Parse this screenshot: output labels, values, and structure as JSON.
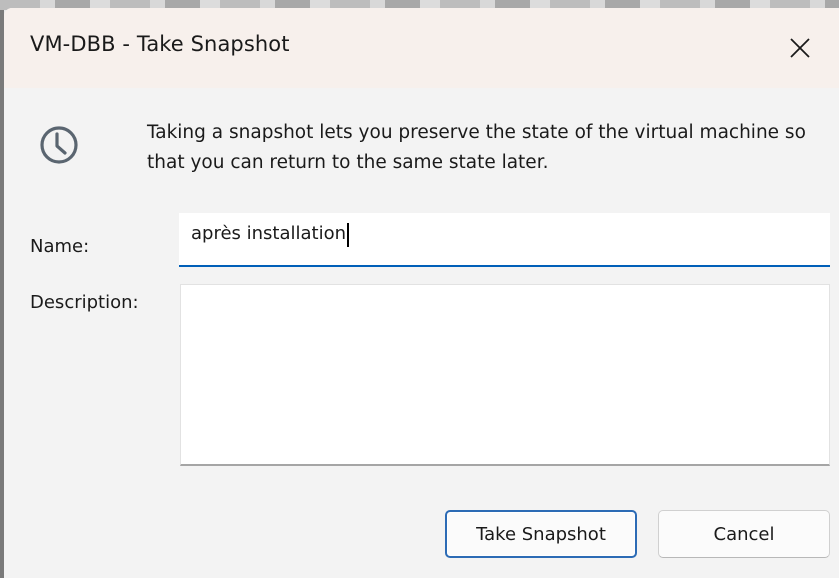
{
  "window": {
    "title": "VM-DBB - Take Snapshot",
    "close_icon": "close-icon"
  },
  "info": {
    "icon": "clock-icon",
    "text": "Taking a snapshot lets you preserve the state of the virtual machine so that you can return to the same state later."
  },
  "form": {
    "name_label": "Name:",
    "name_value": "après installation",
    "description_label": "Description:",
    "description_value": ""
  },
  "buttons": {
    "take_snapshot": "Take Snapshot",
    "cancel": "Cancel"
  },
  "colors": {
    "accent": "#005fb8",
    "titlebar": "#f7f0ec",
    "dialog_bg": "#f3f3f3"
  }
}
